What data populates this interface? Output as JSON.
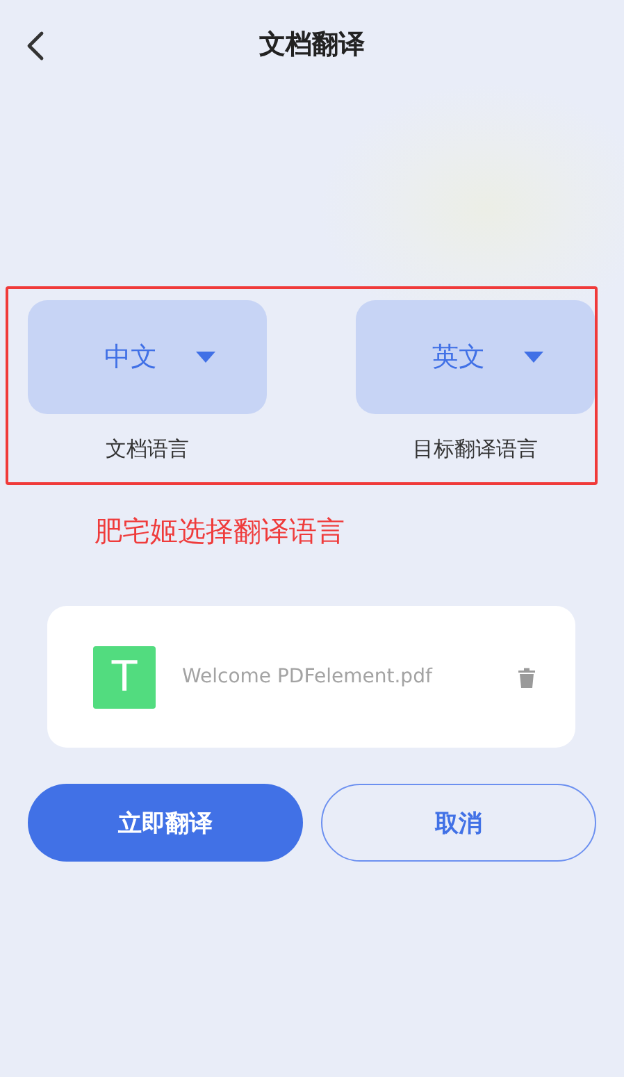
{
  "header": {
    "title": "文档翻译"
  },
  "languages": [
    {
      "value": "中文",
      "label": "文档语言"
    },
    {
      "value": "英文",
      "label": "目标翻译语言"
    }
  ],
  "annotation": "肥宅姬选择翻译语言",
  "file": {
    "icon_letter": "T",
    "name": "Welcome PDFelement.pdf"
  },
  "buttons": [
    {
      "label": "立即翻译",
      "kind": "primary"
    },
    {
      "label": "取消",
      "kind": "secondary"
    }
  ]
}
